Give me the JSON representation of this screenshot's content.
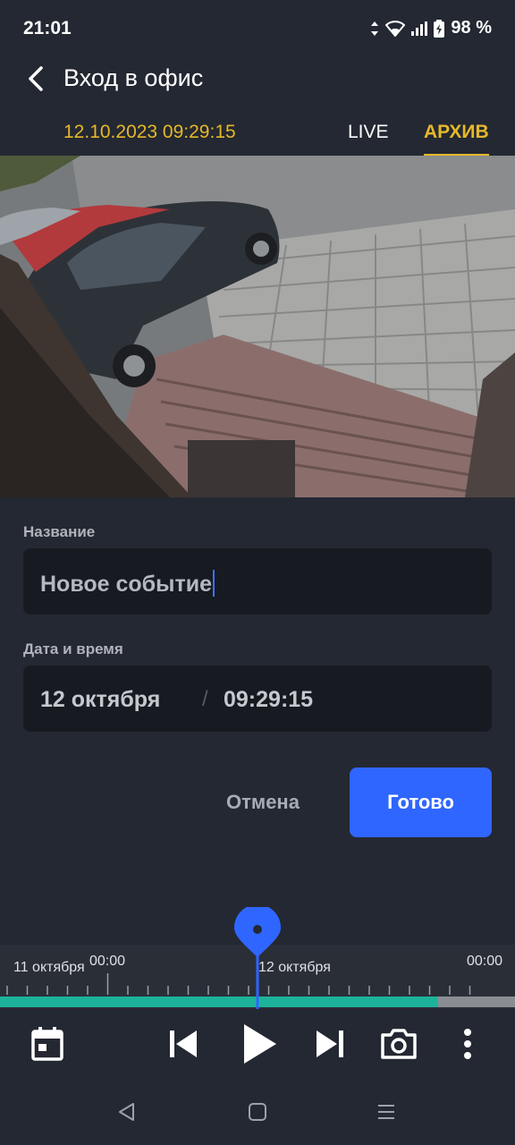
{
  "status_bar": {
    "time": "21:01",
    "battery_percent": "98 %"
  },
  "header": {
    "title": "Вход в офис"
  },
  "player": {
    "datetime": "12.10.2023 09:29:15",
    "tabs": [
      "LIVE",
      "АРХИВ"
    ],
    "active_tab": "АРХИВ"
  },
  "form": {
    "name_label": "Название",
    "name_value": "Новое событие",
    "datetime_label": "Дата и время",
    "date_value": "12 октября",
    "separator": "/",
    "time_value": "09:29:15",
    "cancel_label": "Отмена",
    "done_label": "Готово"
  },
  "timeline": {
    "labels": [
      "11 октября",
      "00:00",
      "12 октября",
      "00:00"
    ],
    "recorded_fraction": 0.85
  },
  "colors": {
    "background": "#242832",
    "accent": "#e5b82a",
    "primary_button": "#2f66ff",
    "timeline_fill": "#1db39a"
  },
  "icons": [
    "back-arrow-icon",
    "calendar-icon",
    "skip-previous-icon",
    "play-icon",
    "skip-next-icon",
    "camera-icon",
    "more-vert-icon"
  ]
}
